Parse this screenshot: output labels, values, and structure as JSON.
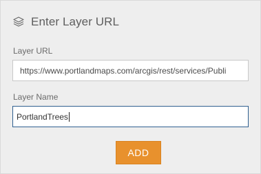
{
  "header": {
    "icon": "layers-icon",
    "title": "Enter Layer URL"
  },
  "form": {
    "url_label": "Layer URL",
    "url_value": "https://www.portlandmaps.com/arcgis/rest/services/Publi",
    "name_label": "Layer Name",
    "name_value": "PortlandTrees"
  },
  "actions": {
    "add_label": "ADD"
  },
  "colors": {
    "panel_bg": "#eeeeee",
    "accent": "#e8912d",
    "focus_border": "#2f5f8f"
  }
}
